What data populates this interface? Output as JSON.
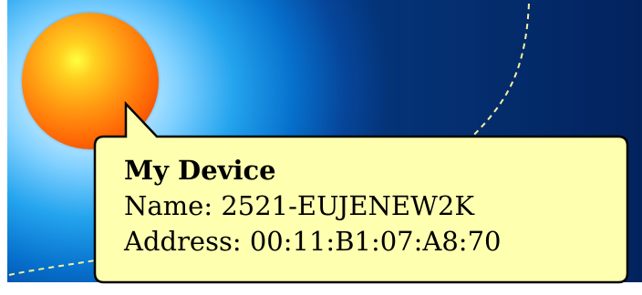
{
  "tooltip": {
    "title": "My Device",
    "name_label": "Name:",
    "name_value": "2521-EUJENEW2K",
    "address_label": "Address:",
    "address_value": "00:11:B1:07:A8:70"
  },
  "colors": {
    "background_center": "#ffffff",
    "background_edge": "#04357a",
    "sphere_core": "#ffff40",
    "sphere_edge": "#c83402",
    "tooltip_fill": "#ffffb0",
    "tooltip_border": "#000000",
    "orbit_line": "#f4f0a0"
  },
  "icons": {
    "device_orb": "orange-sphere-icon"
  }
}
